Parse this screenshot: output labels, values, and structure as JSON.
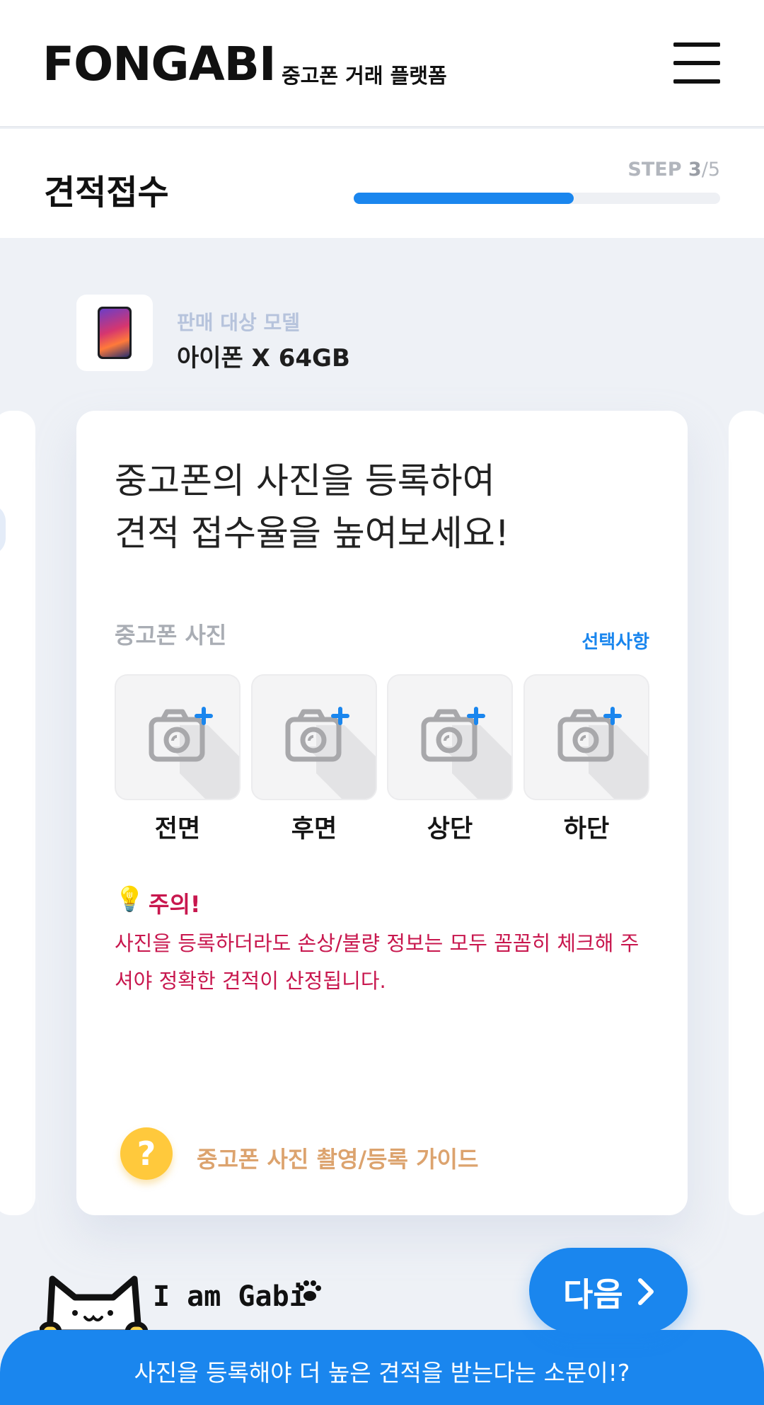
{
  "header": {
    "logo": "FONGABI",
    "tagline": "중고폰 거래 플랫폼",
    "menu_icon": "hamburger-menu-icon"
  },
  "stepbar": {
    "title": "견적접수",
    "step_prefix": "STEP ",
    "step_current": "3",
    "step_sep": "/",
    "step_total": "5",
    "progress": 0.6
  },
  "model": {
    "label": "판매 대상 모델",
    "name": "아이폰 X 64GB",
    "thumb_icon": "iphone-x-thumbnail"
  },
  "card": {
    "headline_line1": "중고폰의 사진을 등록하여",
    "headline_line2": "견적 접수율을 높여보세요!",
    "section_label": "중고폰 사진",
    "optional_label": "선택사항",
    "slots": [
      {
        "label": "전면",
        "icon": "camera-add-icon"
      },
      {
        "label": "후면",
        "icon": "camera-add-icon"
      },
      {
        "label": "상단",
        "icon": "camera-add-icon"
      },
      {
        "label": "하단",
        "icon": "camera-add-icon"
      }
    ],
    "warning_title": "주의!",
    "warning_icon": "lightbulb-icon",
    "warning_text": "사진을 등록하더라도 손상/불량 정보는 모두 꼼꼼히 체크해 주셔야 정확한 견적이 산정됩니다.",
    "guide_icon_symbol": "?",
    "guide_text": "중고폰 사진 촬영/등록 가이드"
  },
  "next_button": {
    "label": "다음"
  },
  "mascot": {
    "text": "I am Gabi"
  },
  "banner": {
    "text": "사진을 등록해야 더 높은 견적을 받는다는 소문이!?"
  },
  "colors": {
    "accent": "#1a86ee",
    "warning": "#c8174e",
    "guide": "#dca36e",
    "guide_icon": "#ffc93c"
  }
}
